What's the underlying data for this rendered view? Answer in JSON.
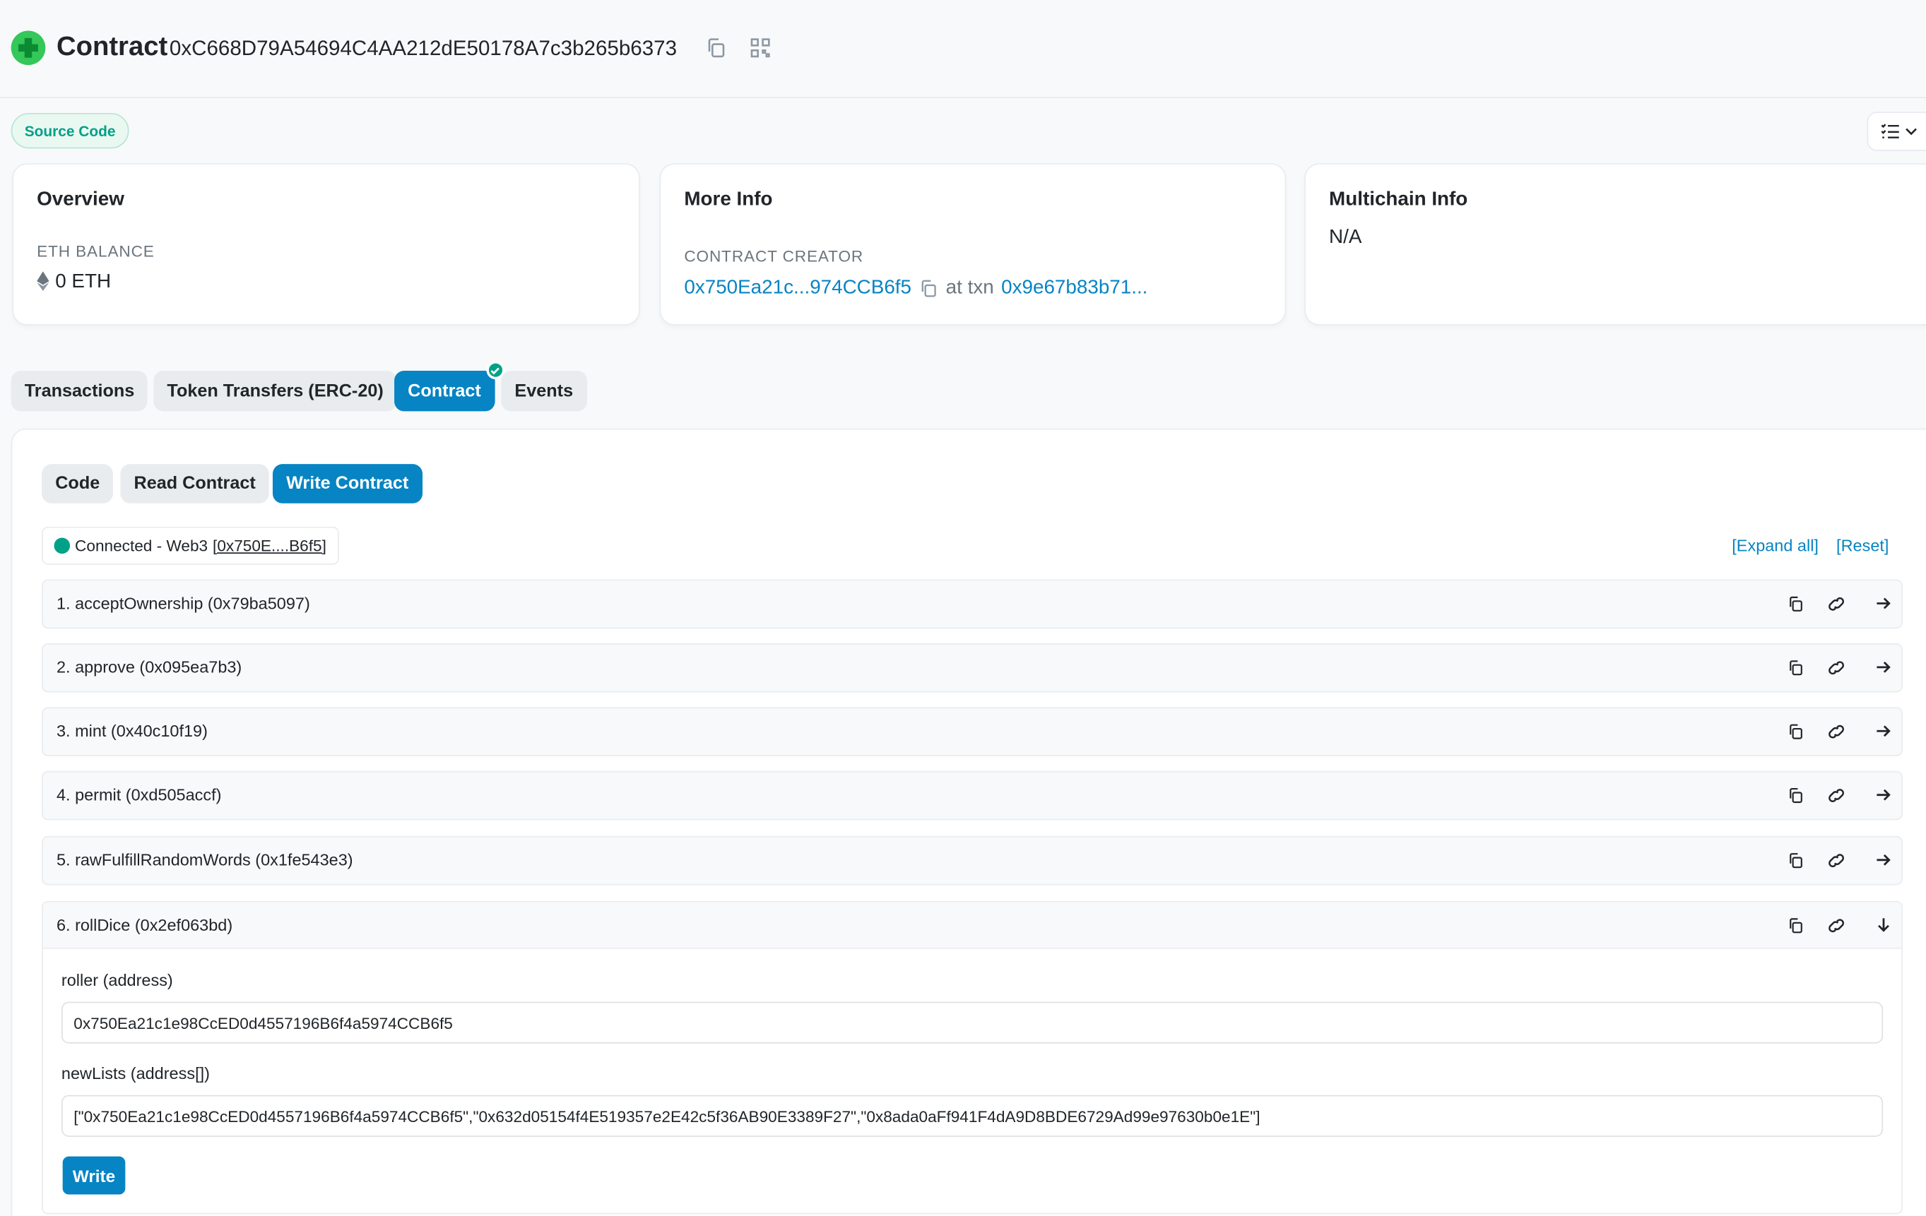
{
  "header": {
    "title": "Contract",
    "address": "0xC668D79A54694C4AA212dE50178A7c3b265b6373",
    "source_badge": "Source Code"
  },
  "cards": {
    "overview": {
      "title": "Overview",
      "balance_label": "ETH BALANCE",
      "balance_value": "0 ETH"
    },
    "more_info": {
      "title": "More Info",
      "creator_label": "CONTRACT CREATOR",
      "creator_address": "0x750Ea21c...974CCB6f5",
      "at_txn": "at txn",
      "txn_hash": "0x9e67b83b71..."
    },
    "multichain": {
      "title": "Multichain Info",
      "value": "N/A"
    }
  },
  "tabs": [
    {
      "label": "Transactions"
    },
    {
      "label": "Token Transfers (ERC-20)"
    },
    {
      "label": "Contract"
    },
    {
      "label": "Events"
    }
  ],
  "subtabs": [
    {
      "label": "Code"
    },
    {
      "label": "Read Contract"
    },
    {
      "label": "Write Contract"
    }
  ],
  "connection": {
    "status": "Connected - Web3",
    "address": "[0x750E....B6f5]",
    "expand_all": "[Expand all]",
    "reset": "[Reset]"
  },
  "functions": [
    {
      "label": "1. acceptOwnership (0x79ba5097)"
    },
    {
      "label": "2. approve (0x095ea7b3)"
    },
    {
      "label": "3. mint (0x40c10f19)"
    },
    {
      "label": "4. permit (0xd505accf)"
    },
    {
      "label": "5. rawFulfillRandomWords (0x1fe543e3)"
    },
    {
      "label": "6. rollDice (0x2ef063bd)"
    }
  ],
  "expanded": {
    "field1_label": "roller (address)",
    "field1_value": "0x750Ea21c1e98CcED0d4557196B6f4a5974CCB6f5",
    "field2_label": "newLists (address[])",
    "field2_value": "[\"0x750Ea21c1e98CcED0d4557196B6f4a5974CCB6f5\",\"0x632d05154f4E519357e2E42c5f36AB90E3389F27\",\"0x8ada0aFf941F4dA9D8BDE6729Ad99e97630b0e1E\"]",
    "write_label": "Write"
  },
  "colors": {
    "primary": "#0784c3",
    "success": "#00a186",
    "muted": "#6c757d"
  }
}
